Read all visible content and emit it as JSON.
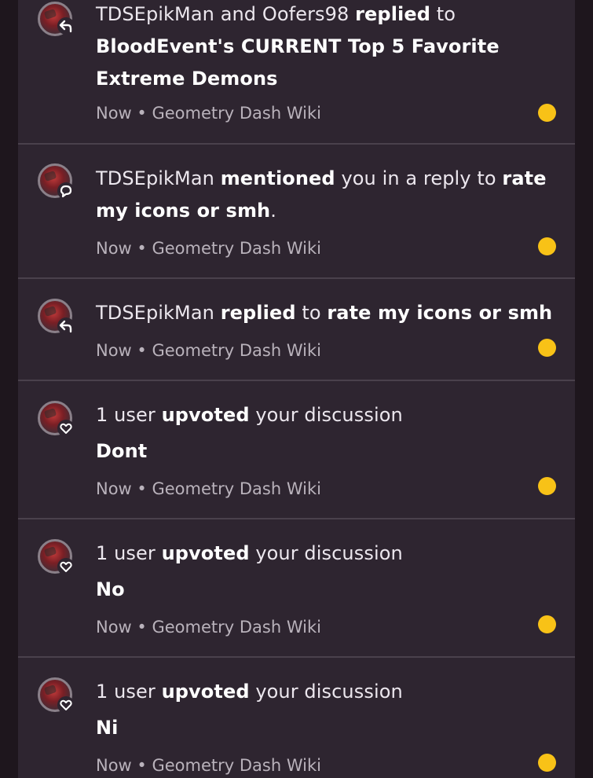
{
  "notifications": [
    {
      "parts": [
        {
          "t": "TDSEpikMan and Oofers98 ",
          "b": false
        },
        {
          "t": "replied",
          "b": true
        },
        {
          "t": " to ",
          "b": false
        },
        {
          "t": "BloodEvent's CURRENT Top 5 Favorite Extreme Demons",
          "b": true
        }
      ],
      "meta": "Now • Geometry Dash Wiki",
      "icon": "reply-icon",
      "unread": true
    },
    {
      "parts": [
        {
          "t": "TDSEpikMan ",
          "b": false
        },
        {
          "t": "mentioned",
          "b": true
        },
        {
          "t": " you in a reply to ",
          "b": false
        },
        {
          "t": "rate my icons or smh",
          "b": true
        },
        {
          "t": ".",
          "b": false
        }
      ],
      "meta": "Now • Geometry Dash Wiki",
      "icon": "speech-bubble-icon",
      "unread": true
    },
    {
      "parts": [
        {
          "t": "TDSEpikMan ",
          "b": false
        },
        {
          "t": "replied",
          "b": true
        },
        {
          "t": " to ",
          "b": false
        },
        {
          "t": "rate my icons or smh",
          "b": true
        }
      ],
      "meta": "Now • Geometry Dash Wiki",
      "icon": "reply-icon",
      "unread": true
    },
    {
      "parts": [
        {
          "t": "1 user ",
          "b": false
        },
        {
          "t": "upvoted",
          "b": true
        },
        {
          "t": " your discussion",
          "b": false
        }
      ],
      "subtitle": "Dont",
      "meta": "Now • Geometry Dash Wiki",
      "icon": "heart-icon",
      "unread": true
    },
    {
      "parts": [
        {
          "t": "1 user ",
          "b": false
        },
        {
          "t": "upvoted",
          "b": true
        },
        {
          "t": " your discussion",
          "b": false
        }
      ],
      "subtitle": "No",
      "meta": "Now • Geometry Dash Wiki",
      "icon": "heart-icon",
      "unread": true
    },
    {
      "parts": [
        {
          "t": "1 user ",
          "b": false
        },
        {
          "t": "upvoted",
          "b": true
        },
        {
          "t": " your discussion",
          "b": false
        }
      ],
      "subtitle": "Ni",
      "meta": "Now • Geometry Dash Wiki",
      "icon": "heart-icon",
      "unread": true
    }
  ],
  "colors": {
    "background": "#1e161d",
    "panel": "#2e2530",
    "divider": "#4a414c",
    "unread_dot": "#f8c217",
    "text": "#ece7ee",
    "meta_text": "#b9b2bb"
  }
}
